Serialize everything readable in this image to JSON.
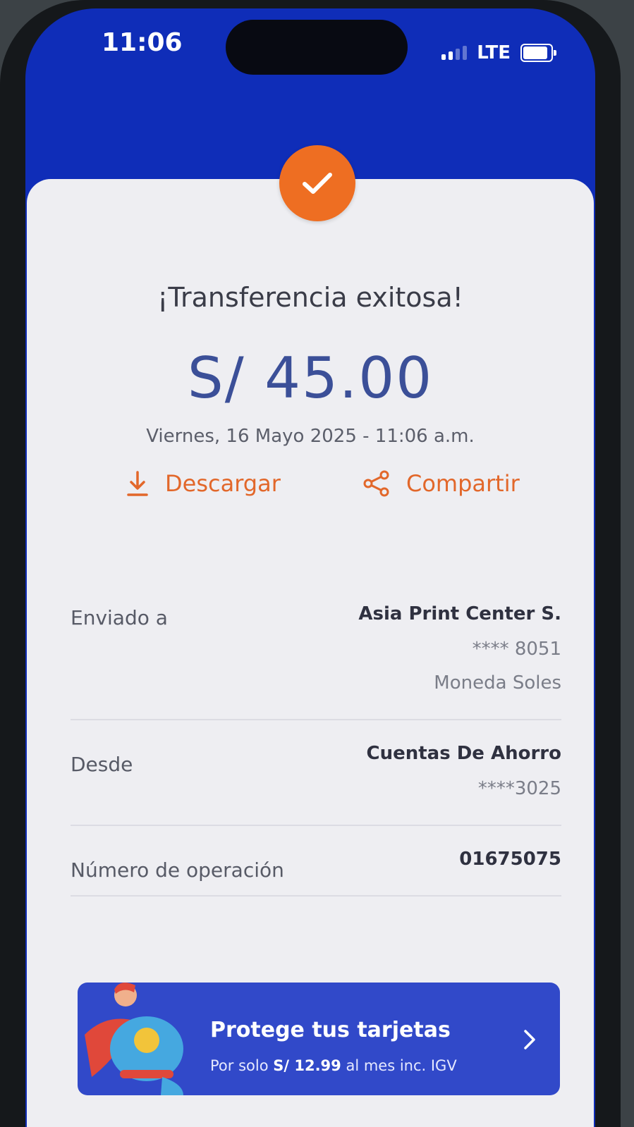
{
  "status_bar": {
    "time": "11:06",
    "network": "LTE"
  },
  "receipt": {
    "title": "¡Transferencia exitosa!",
    "amount": "S/ 45.00",
    "datetime": "Viernes, 16 Mayo 2025 - 11:06 a.m."
  },
  "actions": {
    "download_label": "Descargar",
    "share_label": "Compartir"
  },
  "details": {
    "sent_to": {
      "label": "Enviado a",
      "name": "Asia Print Center S.",
      "account": "**** 8051",
      "currency": "Moneda Soles"
    },
    "from": {
      "label": "Desde",
      "account_type": "Cuentas De Ahorro",
      "account": "****3025"
    },
    "operation": {
      "label": "Número de operación",
      "number": "01675075"
    }
  },
  "promo": {
    "title": "Protege tus tarjetas",
    "sub_prefix": "Por solo",
    "price": "S/ 12.99",
    "sub_suffix": "al mes inc. IGV"
  },
  "colors": {
    "header_blue": "#0f2db8",
    "accent_orange": "#ee6e22",
    "amount_blue": "#3b4f98",
    "promo_blue": "#3149c9"
  },
  "icons": [
    "check-icon",
    "download-icon",
    "share-icon",
    "chevron-right-icon",
    "superhero-illustration"
  ]
}
